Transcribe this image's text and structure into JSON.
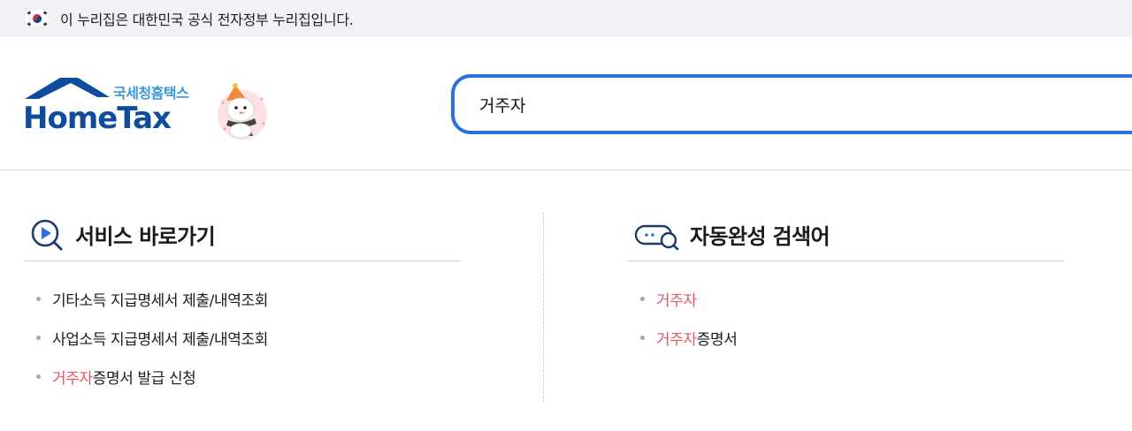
{
  "gov_banner": {
    "text": "이 누리집은 대한민국 공식 전자정부 누리집입니다."
  },
  "logo": {
    "subtitle": "국세청홈택스",
    "title": "HomeTax"
  },
  "search": {
    "value": "거주자"
  },
  "services": {
    "title": "서비스 바로가기",
    "items": [
      {
        "highlight": "",
        "rest": "기타소득 지급명세서 제출/내역조회"
      },
      {
        "highlight": "",
        "rest": "사업소득 지급명세서 제출/내역조회"
      },
      {
        "highlight": "거주자",
        "rest": "증명서 발급 신청"
      }
    ]
  },
  "autocomplete": {
    "title": "자동완성 검색어",
    "items": [
      {
        "highlight": "거주자",
        "rest": ""
      },
      {
        "highlight": "거주자",
        "rest": "증명서"
      }
    ]
  },
  "colors": {
    "brand": "#0f4c9e",
    "search_border": "#2a6fe0",
    "highlight": "#e55561"
  }
}
